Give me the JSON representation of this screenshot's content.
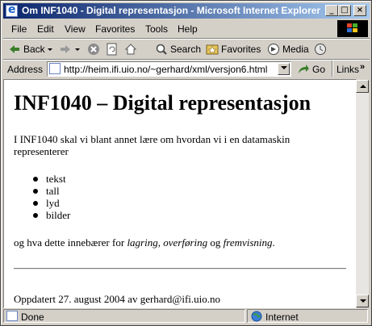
{
  "window": {
    "title": "Om INF1040 - Digital representasjon - Microsoft Internet Explorer",
    "min_glyph": "_",
    "max_glyph": "□",
    "close_glyph": "×"
  },
  "menu": [
    "File",
    "Edit",
    "View",
    "Favorites",
    "Tools",
    "Help"
  ],
  "toolbar": {
    "back_label": "Back",
    "search_label": "Search",
    "favorites_label": "Favorites",
    "media_label": "Media"
  },
  "address": {
    "label": "Address",
    "url": "http://heim.ifi.uio.no/~gerhard/xml/versjon6.html",
    "go_label": "Go",
    "links_label": "Links"
  },
  "page": {
    "heading": "INF1040 – Digital representasjon",
    "intro": "I INF1040 skal vi blant annet lære om hvordan vi i en datamaskin representerer",
    "list": [
      "tekst",
      "tall",
      "lyd",
      "bilder"
    ],
    "para_prefix": "og hva dette innebærer for ",
    "para_em1": "lagring",
    "para_sep1": ", ",
    "para_em2": "overføring",
    "para_sep2": " og ",
    "para_em3": "fremvisning",
    "para_end": ".",
    "footer": "Oppdatert 27. august 2004 av gerhard@ifi.uio.no"
  },
  "status": {
    "text": "Done",
    "zone": "Internet"
  }
}
